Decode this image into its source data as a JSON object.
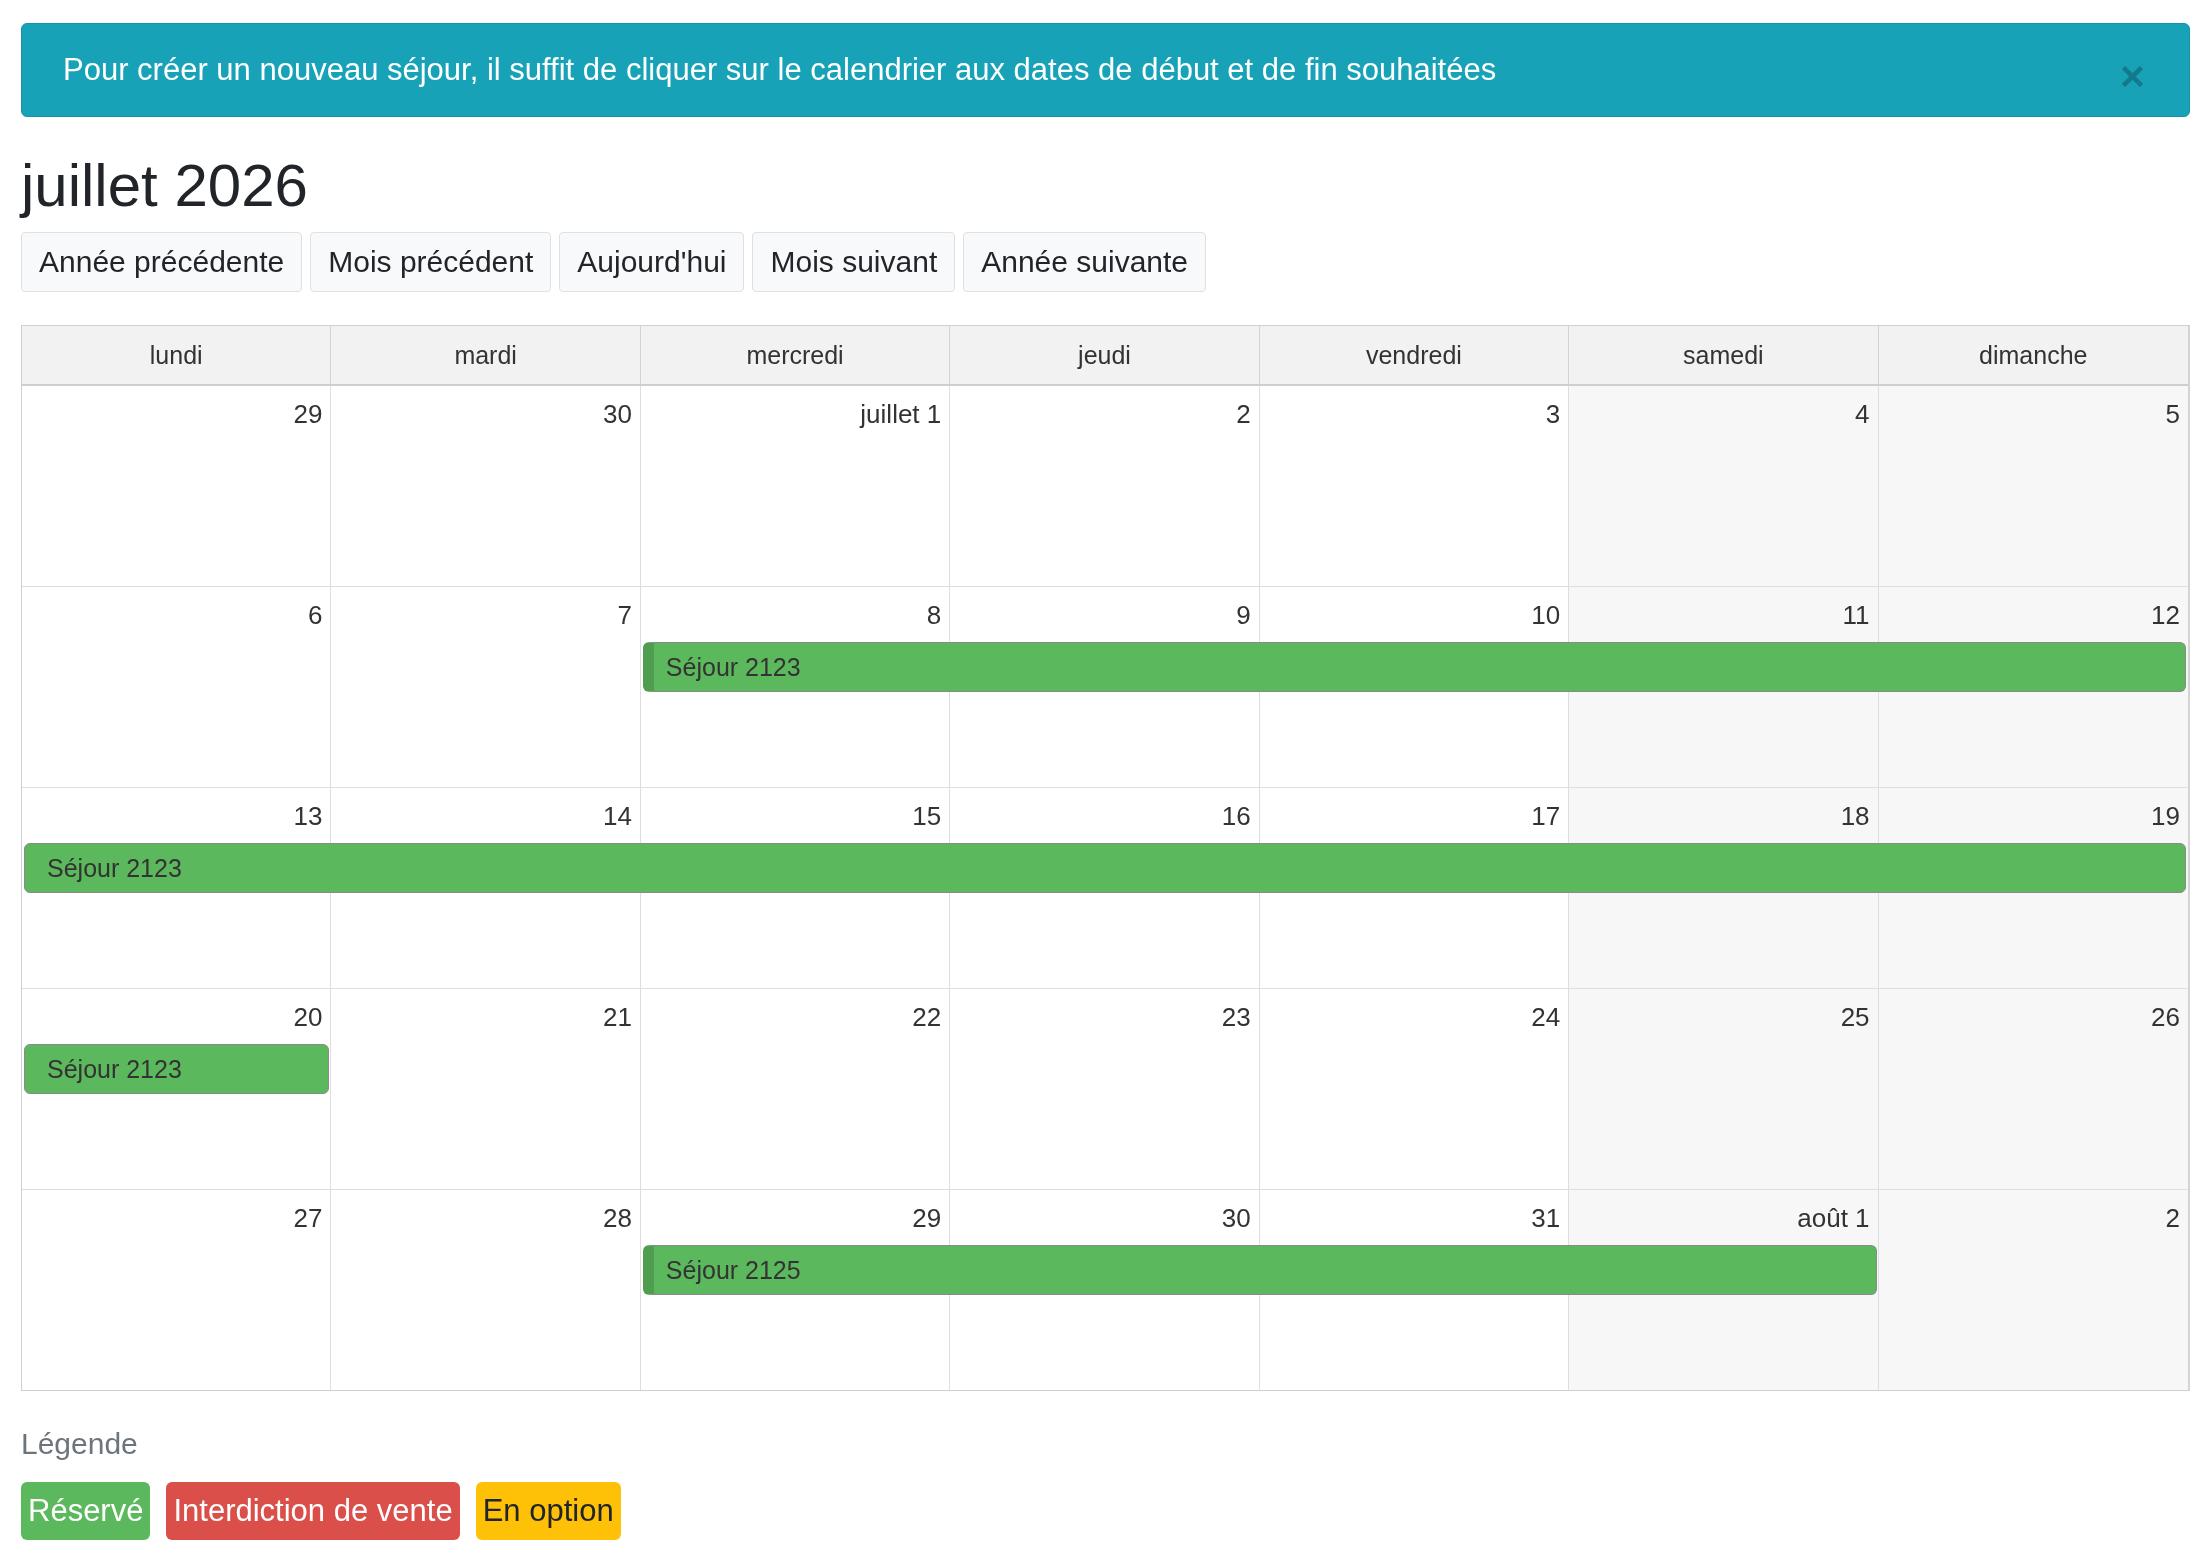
{
  "alert": {
    "message": "Pour créer un nouveau séjour, il suffit de cliquer sur le calendrier aux dates de début et de fin souhaitées"
  },
  "title": "juillet 2026",
  "nav_buttons": [
    "Année précédente",
    "Mois précédent",
    "Aujourd'hui",
    "Mois suivant",
    "Année suivante"
  ],
  "calendar": {
    "weekdays": [
      "lundi",
      "mardi",
      "mercredi",
      "jeudi",
      "vendredi",
      "samedi",
      "dimanche"
    ],
    "weeks": [
      {
        "days": [
          {
            "date": "29",
            "kind": "free"
          },
          {
            "date": "30",
            "kind": "free"
          },
          {
            "date": "juillet 1",
            "kind": "free"
          },
          {
            "date": "2",
            "kind": "free"
          },
          {
            "date": "3",
            "kind": "free"
          },
          {
            "date": "4",
            "kind": "free"
          },
          {
            "date": "5",
            "kind": "free"
          }
        ]
      },
      {
        "days": [
          {
            "date": "6",
            "kind": "free"
          },
          {
            "date": "7",
            "kind": "free"
          },
          {
            "date": "8",
            "kind": "stay",
            "stay": {
              "title": "Séjour 2123",
              "color": "#5cb85c",
              "continues_before": false
            }
          },
          {
            "date": "9",
            "kind": "booked"
          },
          {
            "date": "10",
            "kind": "booked"
          },
          {
            "date": "11",
            "kind": "booked"
          },
          {
            "date": "12",
            "kind": "booked"
          }
        ]
      },
      {
        "days": [
          {
            "date": "13",
            "kind": "stay",
            "stay": {
              "title": "Séjour 2123",
              "color": "#5cb85c",
              "continues_before": true
            }
          },
          {
            "date": "14",
            "kind": "booked"
          },
          {
            "date": "15",
            "kind": "booked"
          },
          {
            "date": "16",
            "kind": "booked"
          },
          {
            "date": "17",
            "kind": "booked"
          },
          {
            "date": "18",
            "kind": "booked"
          },
          {
            "date": "19",
            "kind": "booked"
          }
        ]
      },
      {
        "days": [
          {
            "date": "20",
            "kind": "stay",
            "stay": {
              "title": "Séjour 2123",
              "color": "#5cb85c",
              "continues_before": true
            }
          },
          {
            "date": "21",
            "kind": "free"
          },
          {
            "date": "22",
            "kind": "free"
          },
          {
            "date": "23",
            "kind": "free"
          },
          {
            "date": "24",
            "kind": "free"
          },
          {
            "date": "25",
            "kind": "free"
          },
          {
            "date": "26",
            "kind": "free"
          }
        ]
      },
      {
        "days": [
          {
            "date": "27",
            "kind": "free"
          },
          {
            "date": "28",
            "kind": "free"
          },
          {
            "date": "29",
            "kind": "stay",
            "stay": {
              "title": "Séjour 2125",
              "color": "#5cb85c",
              "continues_before": false
            }
          },
          {
            "date": "30",
            "kind": "booked"
          },
          {
            "date": "31",
            "kind": "booked"
          },
          {
            "date": "août 1",
            "kind": "booked"
          },
          {
            "date": "2",
            "kind": "free"
          }
        ]
      }
    ]
  },
  "legend": {
    "title": "Légende",
    "items": [
      {
        "label": "Réservé",
        "color": "#5cb85c"
      },
      {
        "label": "Interdiction de vente",
        "color": "#da4f49"
      },
      {
        "label": "En option",
        "color": "#ffc107"
      }
    ]
  }
}
